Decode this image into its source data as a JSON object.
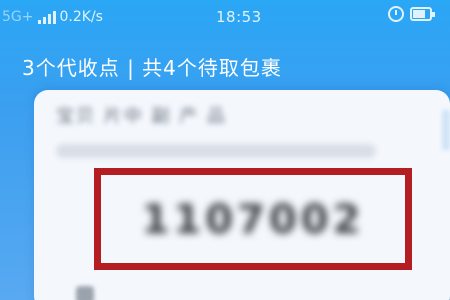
{
  "status_bar": {
    "network_type": "5G+",
    "speed": "0.2K/s",
    "time": "18:53"
  },
  "header": {
    "title": "3个代收点 | 共4个待取包裹"
  },
  "card": {
    "blurred_title": "宝贝 片中 副 产 品",
    "pickup_code": "1107002"
  },
  "colors": {
    "background": "#3b9ff0",
    "highlight_box": "#b41e23"
  }
}
